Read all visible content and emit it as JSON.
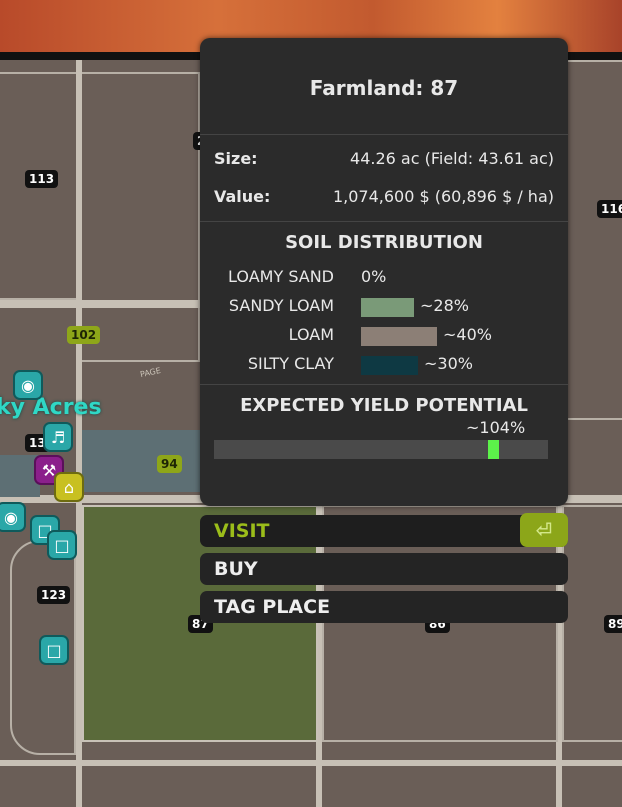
{
  "map": {
    "field_numbers_dark": [
      "113",
      "123",
      "87",
      "86",
      "89",
      "116",
      "2",
      "13"
    ],
    "field_numbers_lime": [
      "102",
      "94"
    ],
    "town_name": "ky Acres",
    "road_label": "PAGE"
  },
  "popup": {
    "title": "Farmland: 87",
    "size_label": "Size:",
    "size_value": "44.26 ac (Field: 43.61 ac)",
    "value_label": "Value:",
    "value_value": "1,074,600 $ (60,896 $ / ha)",
    "soil_title": "SOIL DISTRIBUTION",
    "soils": [
      {
        "name": "LOAMY SAND",
        "pct": "0%",
        "fraction": 0.0,
        "color": "#000000"
      },
      {
        "name": "SANDY LOAM",
        "pct": "~28%",
        "fraction": 0.28,
        "color": "#7a9a78"
      },
      {
        "name": "LOAM",
        "pct": "~40%",
        "fraction": 0.4,
        "color": "#8c7f76"
      },
      {
        "name": "SILTY CLAY",
        "pct": "~30%",
        "fraction": 0.3,
        "color": "#0e3943"
      }
    ],
    "yield_title": "EXPECTED YIELD POTENTIAL",
    "yield_value": "~104%",
    "yield_fraction": 0.82
  },
  "actions": {
    "visit": "VISIT",
    "buy": "BUY",
    "tag_place": "TAG PLACE",
    "enter_glyph": "⏎"
  },
  "colors": {
    "accent": "#8ca619",
    "yield_marker": "#5cf24a",
    "panel_bg": "#2b2b2b"
  }
}
